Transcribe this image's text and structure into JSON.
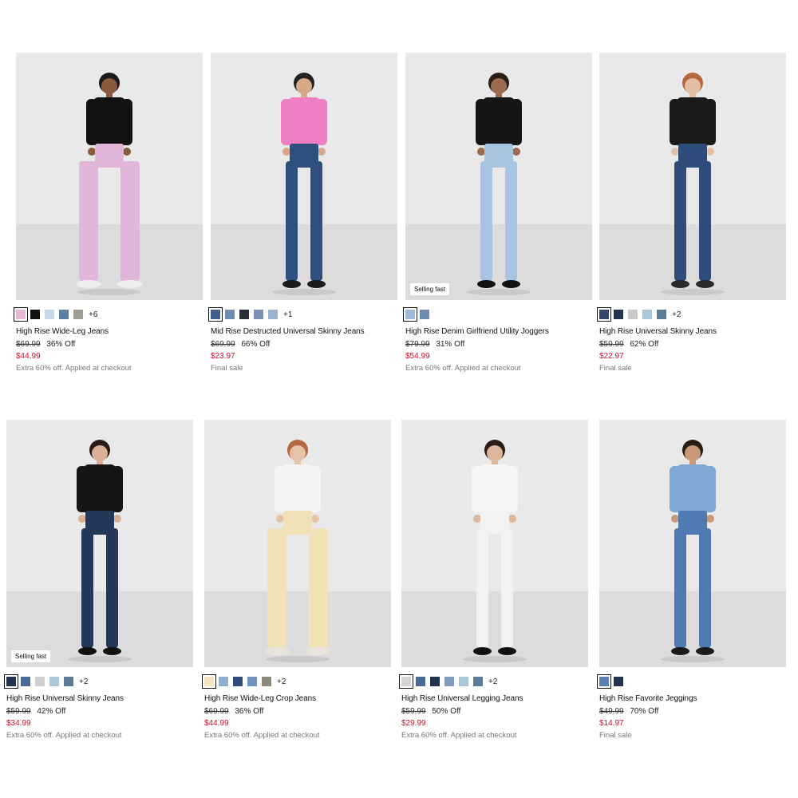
{
  "colors": {
    "sale": "#c8102e",
    "promo": "#777777"
  },
  "products": [
    {
      "title": "High Rise Wide-Leg Jeans",
      "was": "$69.99",
      "off": "36% Off",
      "now": "$44.99",
      "promo": "Extra 60% off. Applied at checkout",
      "badge": "",
      "swatches": [
        "#e7b8d6",
        "#111111",
        "#c6d7e8",
        "#5d7ea3",
        "#a09d93"
      ],
      "more": "+6",
      "model": {
        "top": "#111111",
        "bottom": "#e2b6d8",
        "skin": "#8a5a3c",
        "hair": "#1a1a1a",
        "shoe": "#eeeeee",
        "wide": true
      }
    },
    {
      "title": "Mid Rise Destructed Universal Skinny Jeans",
      "was": "$69.99",
      "off": "66% Off",
      "now": "$23.97",
      "promo": "Final sale",
      "badge": "",
      "swatches": [
        "#3f5f8a",
        "#6d8bb0",
        "#2a2d36",
        "#7b8fb4",
        "#9bb3cc"
      ],
      "more": "+1",
      "model": {
        "top": "#ef7fc3",
        "bottom": "#2f4f7e",
        "skin": "#d6a98a",
        "hair": "#222222",
        "shoe": "#1a1a1a",
        "wide": false
      }
    },
    {
      "title": "High Rise Denim Girlfriend Utility Joggers",
      "was": "$79.99",
      "off": "31% Off",
      "now": "$54.99",
      "promo": "Extra 60% off. Applied at checkout",
      "badge": "Selling fast",
      "swatches": [
        "#9ebad6",
        "#6d8bb0"
      ],
      "more": "",
      "model": {
        "top": "#151515",
        "bottom": "#a9c4e0",
        "skin": "#9a6b4e",
        "hair": "#2a1d16",
        "shoe": "#111111",
        "wide": false
      }
    },
    {
      "title": "High Rise Universal Skinny Jeans",
      "was": "$59.99",
      "off": "62% Off",
      "now": "$22.97",
      "promo": "Final sale",
      "badge": "",
      "swatches": [
        "#34476a",
        "#243552",
        "#c9c9c9",
        "#a9c7d6",
        "#5c7c96"
      ],
      "more": "+2",
      "model": {
        "top": "#1a1a1a",
        "bottom": "#2e4d7a",
        "skin": "#e2bfa5",
        "hair": "#b5673d",
        "shoe": "#2a2a2a",
        "wide": false
      }
    },
    {
      "title": "High Rise Universal Skinny Jeans",
      "was": "$59.99",
      "off": "42% Off",
      "now": "$34.99",
      "promo": "Extra 60% off. Applied at checkout",
      "badge": "Selling fast",
      "swatches": [
        "#22324f",
        "#4b6a93",
        "#cfcfcf",
        "#a9c7d6",
        "#5c7c96"
      ],
      "more": "+2",
      "model": {
        "top": "#151515",
        "bottom": "#24385a",
        "skin": "#d9b095",
        "hair": "#2a1d16",
        "shoe": "#111111",
        "wide": false
      }
    },
    {
      "title": "High Rise Wide-Leg Crop Jeans",
      "was": "$69.99",
      "off": "36% Off",
      "now": "$44.99",
      "promo": "Extra 60% off. Applied at checkout",
      "badge": "",
      "swatches": [
        "#f3e3be",
        "#8fb1cf",
        "#2e4d7a",
        "#6d93c2",
        "#8a8a77"
      ],
      "more": "+2",
      "model": {
        "top": "#f4f4f6",
        "bottom": "#f1e1b8",
        "skin": "#e6c3a8",
        "hair": "#b5673d",
        "shoe": "#e8e4dc",
        "wide": true
      }
    },
    {
      "title": "High Rise Universal Legging Jeans",
      "was": "$59.99",
      "off": "50% Off",
      "now": "$29.99",
      "promo": "Extra 60% off. Applied at checkout",
      "badge": "",
      "swatches": [
        "#d4d4d4",
        "#4b6a93",
        "#22324f",
        "#7f9cc0",
        "#a9c7d6",
        "#5c7c96"
      ],
      "more": "+2",
      "model": {
        "top": "#f5f5f5",
        "bottom": "#f2f2f2",
        "skin": "#dcb79c",
        "hair": "#2a1d16",
        "shoe": "#111111",
        "wide": false
      }
    },
    {
      "title": "High Rise Favorite Jeggings",
      "was": "$49.99",
      "off": "70% Off",
      "now": "$14.97",
      "promo": "Final sale",
      "badge": "",
      "swatches": [
        "#5a7fb0",
        "#22324f"
      ],
      "more": "",
      "model": {
        "top": "#7ea7d6",
        "bottom": "#4f79b2",
        "skin": "#c9977a",
        "hair": "#2a1d16",
        "shoe": "#1a1a1a",
        "wide": false
      }
    }
  ]
}
